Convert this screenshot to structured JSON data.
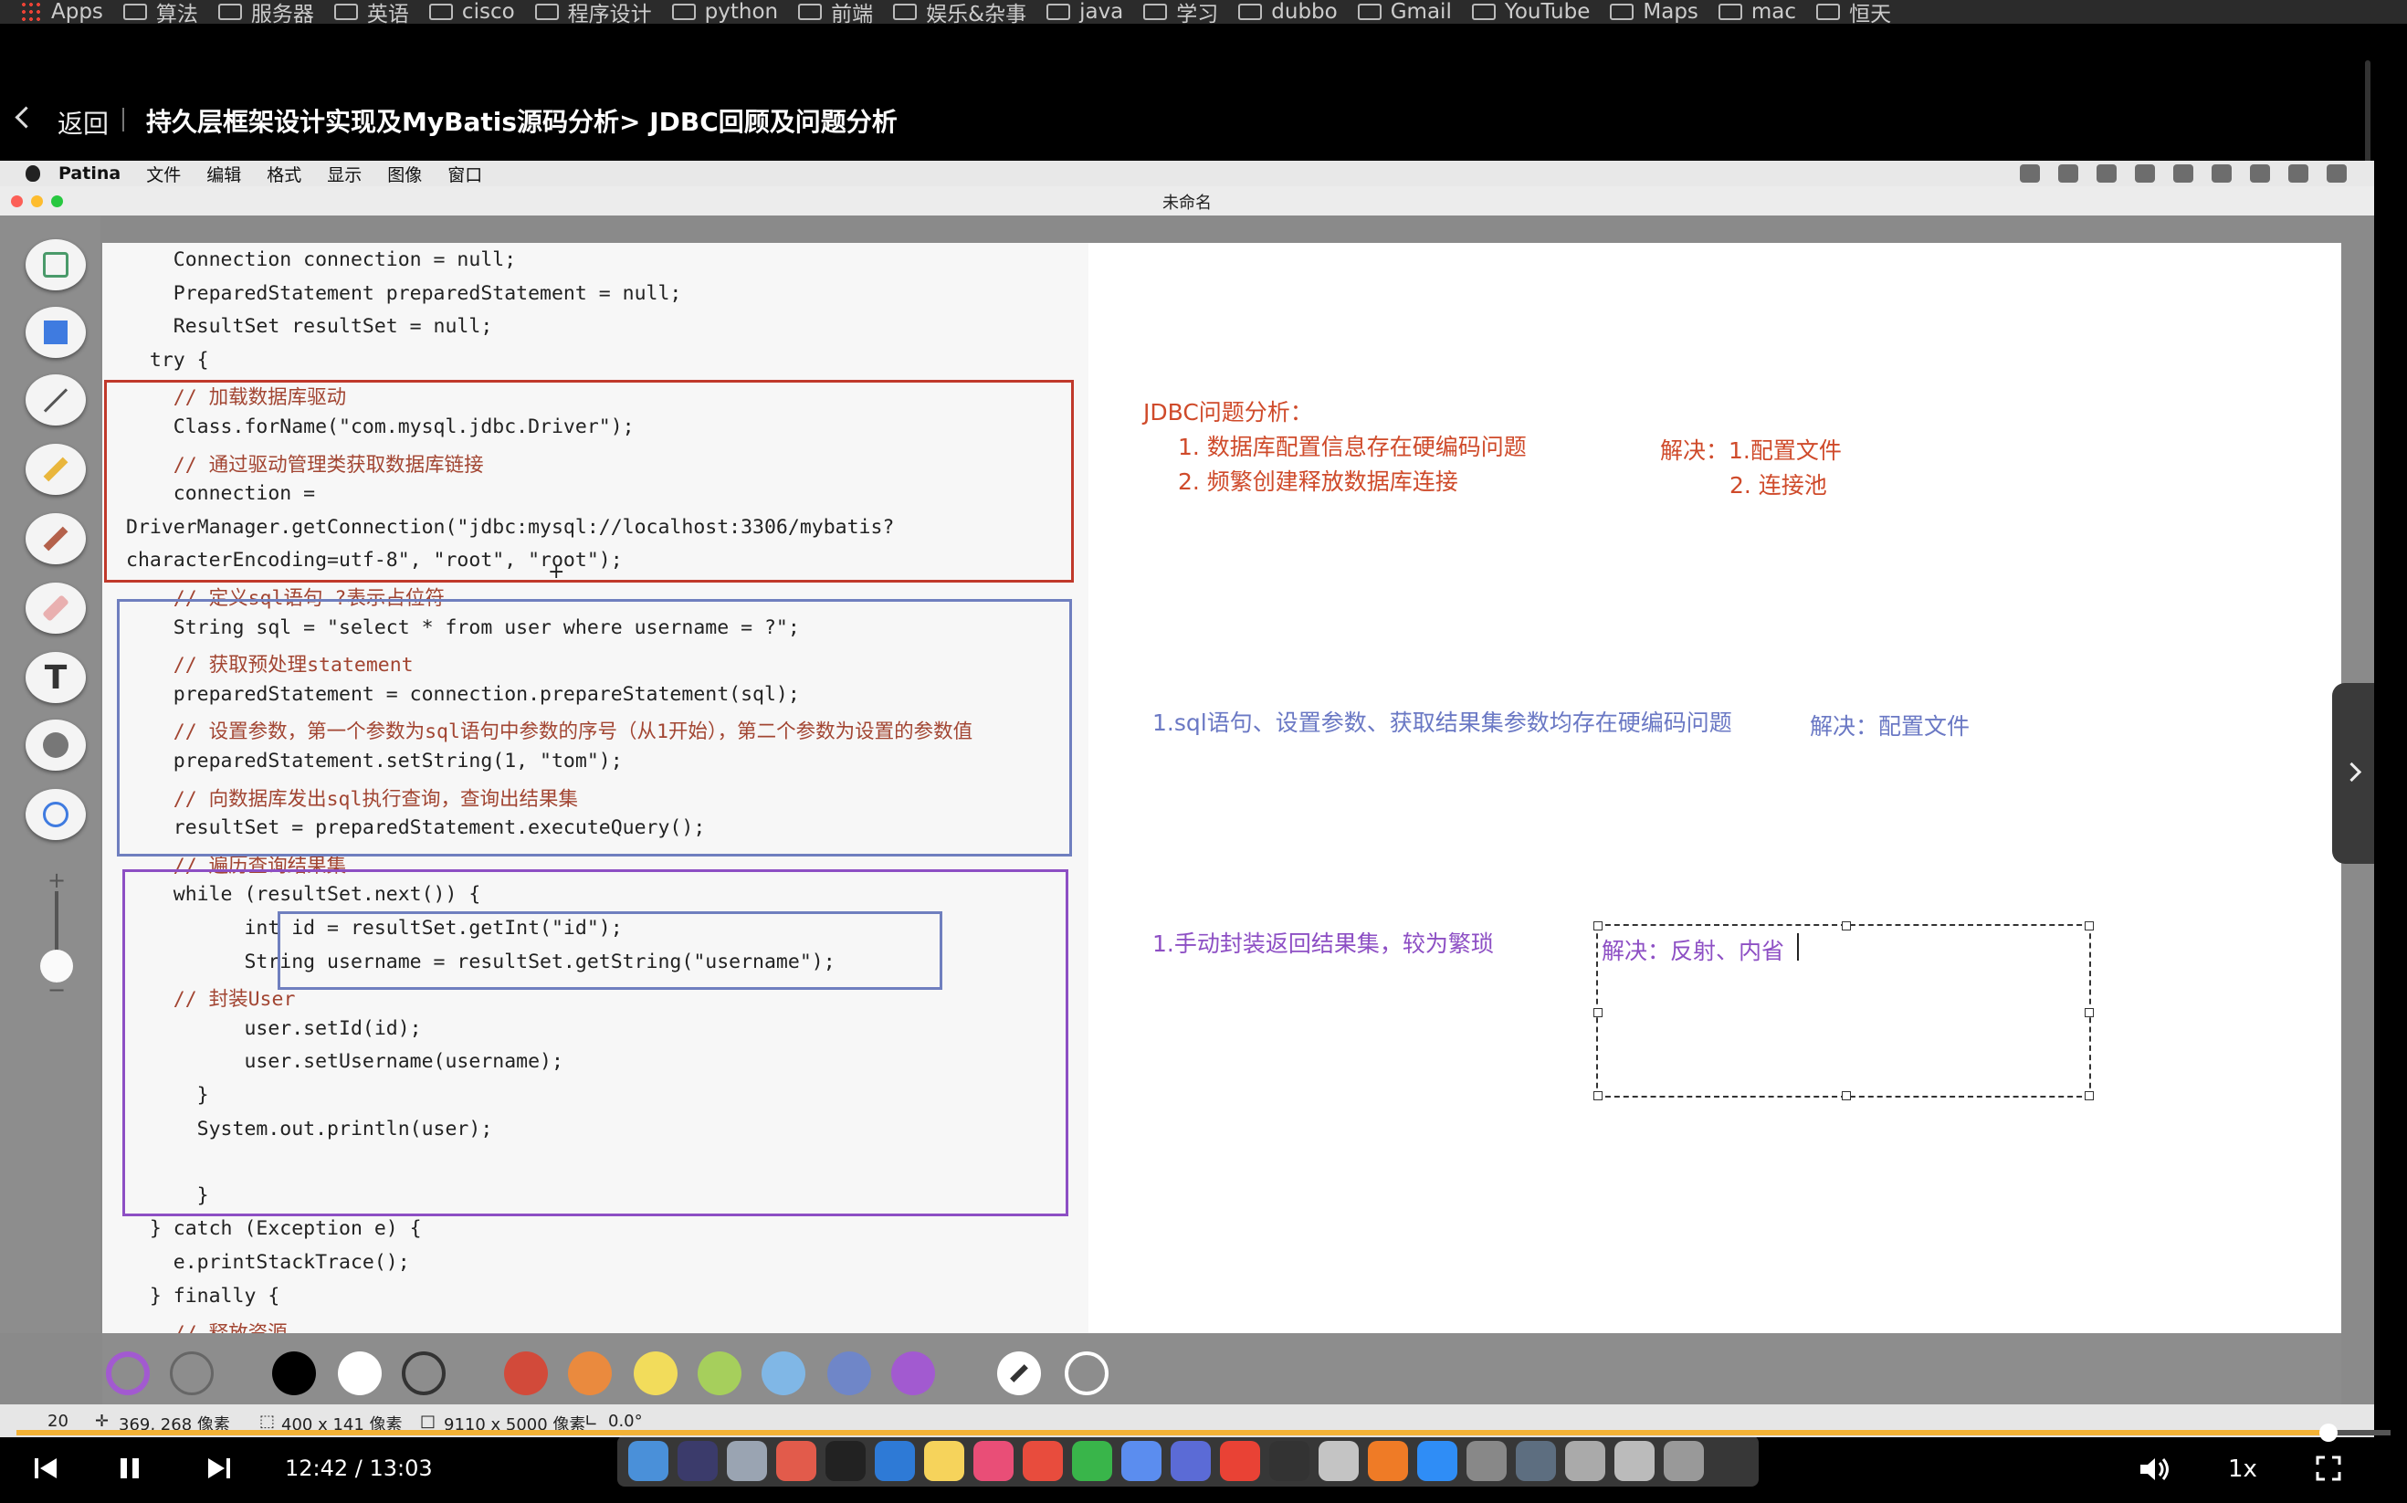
{
  "bookmarks": [
    "Apps",
    "算法",
    "服务器",
    "英语",
    "cisco",
    "程序设计",
    "python",
    "前端",
    "娱乐&杂事",
    "java",
    "学习",
    "dubbo",
    "Gmail",
    "YouTube",
    "Maps",
    "mac",
    "恒天"
  ],
  "header": {
    "back_label": "返回",
    "title": "持久层框架设计实现及MyBatis源码分析> JDBC回顾及问题分析"
  },
  "mac_menu": {
    "app_name": "Patina",
    "items": [
      "文件",
      "编辑",
      "格式",
      "显示",
      "图像",
      "窗口"
    ]
  },
  "window": {
    "title": "未命名"
  },
  "code_lines": [
    "    Connection connection = null;",
    "    PreparedStatement preparedStatement = null;",
    "    ResultSet resultSet = null;",
    "  try {",
    "    // 加载数据库驱动",
    "    Class.forName(\"com.mysql.jdbc.Driver\");",
    "    // 通过驱动管理类获取数据库链接",
    "    connection =",
    "DriverManager.getConnection(\"jdbc:mysql://localhost:3306/mybatis?",
    "characterEncoding=utf-8\", \"root\", \"root\");",
    "    // 定义sql语句 ?表示占位符",
    "    String sql = \"select * from user where username = ?\";",
    "    // 获取预处理statement",
    "    preparedStatement = connection.prepareStatement(sql);",
    "    // 设置参数，第一个参数为sql语句中参数的序号（从1开始），第二个参数为设置的参数值",
    "    preparedStatement.setString(1, \"tom\");",
    "    // 向数据库发出sql执行查询，查询出结果集",
    "    resultSet = preparedStatement.executeQuery();",
    "    // 遍历查询结果集",
    "    while (resultSet.next()) {",
    "          int id = resultSet.getInt(\"id\");",
    "          String username = resultSet.getString(\"username\");",
    "    // 封装User",
    "          user.setId(id);",
    "          user.setUsername(username);",
    "      }",
    "      System.out.println(user);",
    "",
    "      }",
    "  } catch (Exception e) {",
    "    e.printStackTrace();",
    "  } finally {",
    "    // 释放资源"
  ],
  "notes": {
    "jdbc_title": "JDBC问题分析：",
    "jdbc_item1": "1. 数据库配置信息存在硬编码问题",
    "jdbc_item2": "2. 频繁创建释放数据库连接",
    "jdbc_solution1": "解决：1.配置文件",
    "jdbc_solution2": "2. 连接池",
    "sql_problem": "1.sql语句、设置参数、获取结果集参数均存在硬编码问题",
    "sql_solution": "解决：配置文件",
    "result_problem": "1.手动封装返回结果集，较为繁琐",
    "result_solution": "解决：反射、内省"
  },
  "colors": {
    "red_note": "#cf4a2a",
    "blue_note": "#6a78c4",
    "purple_note": "#8d4fc4",
    "progress": "#f3b236"
  },
  "palette_colors": [
    "#000000",
    "#ffffff",
    "transparent",
    "#d24a3a",
    "#ea8a3e",
    "#f2dc5b",
    "#a6cf5c",
    "#80b7e6",
    "#6f86c8",
    "#a25ad0"
  ],
  "status": {
    "size_value": "20",
    "cursor_pos": "369, 268 像素",
    "selection": "400 x 141 像素",
    "canvas_size": "9110 x 5000 像素",
    "angle": "0.0°"
  },
  "player": {
    "time": "12:42 / 13:03",
    "progress": 0.974,
    "speed": "1x"
  },
  "tools": [
    "select-tool",
    "rectangle-tool",
    "line-tool",
    "pencil-tool",
    "brush-tool",
    "eraser-tool",
    "text-tool",
    "fill-tool",
    "zoom-tool"
  ]
}
